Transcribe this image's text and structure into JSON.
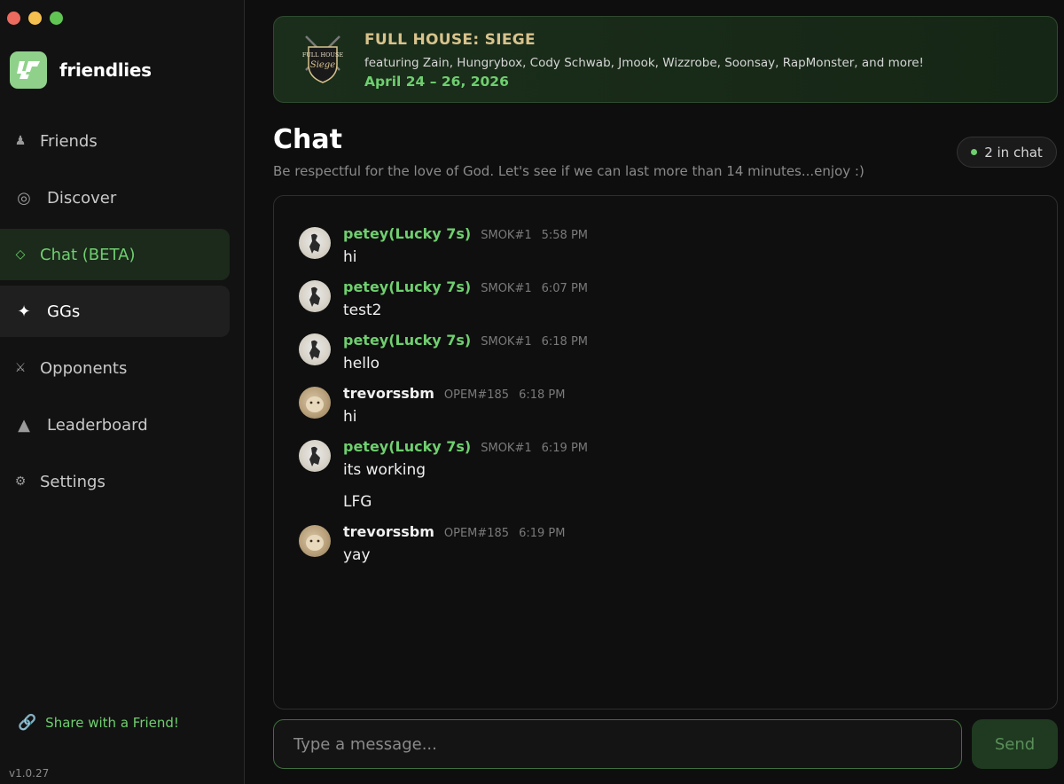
{
  "app": {
    "name": "friendlies",
    "version": "v1.0.27",
    "share_label": "Share with a Friend!"
  },
  "sidebar": {
    "items": [
      {
        "label": "Friends",
        "icon": "pawn-icon",
        "glyph": "♟"
      },
      {
        "label": "Discover",
        "icon": "target-icon",
        "glyph": "◎"
      },
      {
        "label": "Chat (BETA)",
        "icon": "diamond-icon",
        "glyph": "◇"
      },
      {
        "label": "GGs",
        "icon": "sparkle-icon",
        "glyph": "✦"
      },
      {
        "label": "Opponents",
        "icon": "swords-icon",
        "glyph": "⚔"
      },
      {
        "label": "Leaderboard",
        "icon": "triangle-icon",
        "glyph": "▲"
      },
      {
        "label": "Settings",
        "icon": "gear-icon",
        "glyph": "⚙"
      }
    ],
    "share_glyph": "🔗"
  },
  "banner": {
    "title": "FULL HOUSE: SIEGE",
    "subtitle": "featuring Zain, Hungrybox, Cody Schwab, Jmook, Wizzrobe, Soonsay, RapMonster, and more!",
    "dates": "April 24 – 26, 2026",
    "badge_line1": "FULL HOUSE",
    "badge_line2": "Siege"
  },
  "chat": {
    "title": "Chat",
    "description": "Be respectful for the love of God. Let's see if we can last more than 14 minutes...enjoy :)",
    "online_count": "2 in chat",
    "messages": [
      {
        "name": "petey(Lucky 7s)",
        "tag": "SMOK#1",
        "time": "5:58 PM",
        "text": "hi",
        "text2": ""
      },
      {
        "name": "petey(Lucky 7s)",
        "tag": "SMOK#1",
        "time": "6:07 PM",
        "text": "test2",
        "text2": ""
      },
      {
        "name": "petey(Lucky 7s)",
        "tag": "SMOK#1",
        "time": "6:18 PM",
        "text": "hello",
        "text2": ""
      },
      {
        "name": "trevorssbm",
        "tag": "OPEM#185",
        "time": "6:18 PM",
        "text": "hi",
        "text2": ""
      },
      {
        "name": "petey(Lucky 7s)",
        "tag": "SMOK#1",
        "time": "6:19 PM",
        "text": "its working",
        "text2": "LFG"
      },
      {
        "name": "trevorssbm",
        "tag": "OPEM#185",
        "time": "6:19 PM",
        "text": "yay",
        "text2": ""
      }
    ]
  },
  "composer": {
    "placeholder": "Type a message...",
    "send_label": "Send"
  },
  "colors": {
    "accent": "#6fcf6f",
    "banner_title": "#d8c38c",
    "sidebar_bg": "#121212",
    "active_bg": "#1b2a1b"
  }
}
